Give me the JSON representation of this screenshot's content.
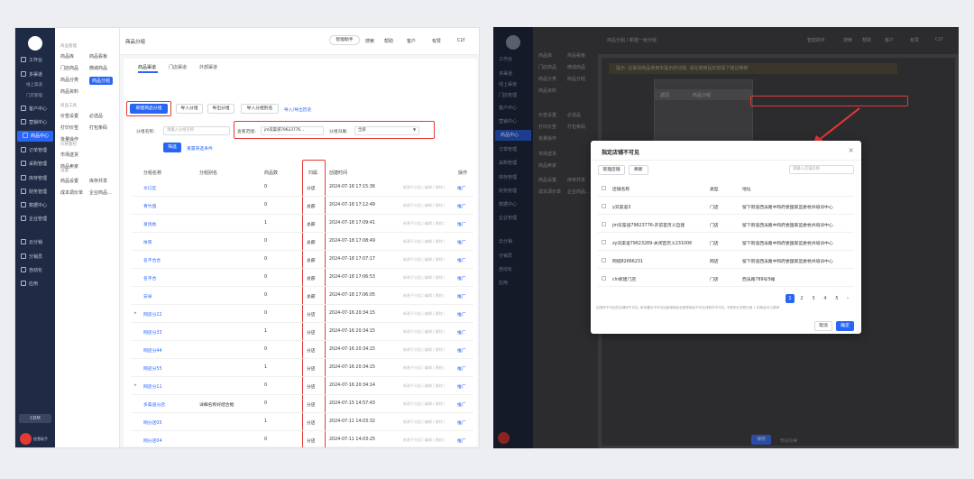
{
  "left": {
    "nav": {
      "items": [
        "工作台",
        "多渠道",
        "线上渠道",
        "门店管理",
        "客户中心",
        "营销中心",
        "商品中心",
        "订单管理",
        "采购管理",
        "库存管理",
        "财务管理",
        "数据中心",
        "企业管理",
        "云分销",
        "分销员",
        "自动化",
        "应用"
      ],
      "crm": "CRM",
      "foot": "经营助手"
    },
    "submenu": {
      "h1": "商品管理",
      "c1": [
        "商品库",
        "门店商品",
        "商品分类",
        "商品资料"
      ],
      "c2": [
        "商品看板",
        "微城商品",
        "商品分组"
      ],
      "h2": "商品工具",
      "c3": [
        "价签设置",
        "打印价签",
        "批量操作"
      ],
      "c4": [
        "必选品",
        "打包条码"
      ],
      "h3": "价格管控",
      "c5": [
        "市场送货",
        "商品卖家"
      ],
      "h4": "设置",
      "c6": [
        "商品设置",
        "成本调价单"
      ],
      "c7": [
        "库存共享",
        "企业商品..."
      ]
    },
    "topbar": {
      "title": "商品分组",
      "assistant": "智能助手",
      "search": "搜索",
      "help": "帮助",
      "customer": "客户",
      "news": "有赞",
      "user": "CLY"
    },
    "tabs": [
      "商品渠道",
      "门店渠道",
      "外部渠道"
    ],
    "toolbar": {
      "new": "新建商品分组",
      "import": "导入分组",
      "export": "导出分组",
      "import_alias": "导入分组别名",
      "history": "导入/导出历史"
    },
    "filters": {
      "name_label": "分组名称:",
      "name_ph": "请输入分组名称",
      "scope_label": "查看范围:",
      "scope_val": "jm双渠道79623776...",
      "belong_label": "分组归属:",
      "belong_val": "全部",
      "filter_btn": "筛选",
      "reset": "重置筛选条件"
    },
    "table": {
      "headers": [
        "分组名称",
        "分组别名",
        "商品数",
        "归属",
        "创建时间",
        "操作"
      ],
      "rows": [
        {
          "name": "文口区",
          "alias": "",
          "count": "0",
          "belong": "分店",
          "time": "2024-07-18 17:15:36"
        },
        {
          "name": "青竹亩",
          "alias": "",
          "count": "0",
          "belong": "总部",
          "time": "2024-07-18 17:12:49"
        },
        {
          "name": "发烧他",
          "alias": "",
          "count": "1",
          "belong": "总部",
          "time": "2024-07-18 17:09:41"
        },
        {
          "name": "体育",
          "alias": "",
          "count": "0",
          "belong": "总部",
          "time": "2024-07-18 17:08:49"
        },
        {
          "name": "名不合合",
          "alias": "",
          "count": "0",
          "belong": "总部",
          "time": "2024-07-18 17:07:17"
        },
        {
          "name": "名平合",
          "alias": "",
          "count": "0",
          "belong": "总部",
          "time": "2024-07-18 17:06:53"
        },
        {
          "name": "安卓",
          "alias": "",
          "count": "0",
          "belong": "总部",
          "time": "2024-07-18 17:06:05"
        },
        {
          "name": "网店分22",
          "alias": "",
          "count": "0",
          "belong": "分店",
          "time": "2024-07-16 20:34:15"
        },
        {
          "name": "网店分33",
          "alias": "",
          "count": "1",
          "belong": "分店",
          "time": "2024-07-16 20:34:15"
        },
        {
          "name": "网店分44",
          "alias": "",
          "count": "0",
          "belong": "分店",
          "time": "2024-07-16 20:34:15"
        },
        {
          "name": "网店分55",
          "alias": "",
          "count": "1",
          "belong": "分店",
          "time": "2024-07-16 20:34:15"
        },
        {
          "name": "网店分11",
          "alias": "",
          "count": "0",
          "belong": "分店",
          "time": "2024-07-16 20:34:14"
        },
        {
          "name": "多渠道分店",
          "alias": "详细名称好结合框",
          "count": "0",
          "belong": "分店",
          "time": "2024-07-15 14:57:43"
        },
        {
          "name": "网分店05",
          "alias": "",
          "count": "1",
          "belong": "分店",
          "time": "2024-07-11 14:03:32"
        },
        {
          "name": "网分店04",
          "alias": "",
          "count": "0",
          "belong": "分店",
          "time": "2024-07-11 14:03:25"
        },
        {
          "name": "网分店03",
          "alias": "",
          "count": "0",
          "belong": "分店",
          "time": "2024-07-11 14:03:04"
        }
      ],
      "op_gray": "新建子分组 | 编辑 | 删除 |",
      "op_blue": "推广"
    }
  },
  "right": {
    "breadcrumb": "商品分组 / 新建一级分组",
    "warn": "提示: 在渠道商品使用本提示的功能, 请在使用后的前提下建议推荐",
    "phone": {
      "back": "返回",
      "title": "商品分组"
    },
    "modal": {
      "title": "指定店铺不可见",
      "manage": "管理店铺",
      "refresh": "刷新",
      "search_ph": "请输入店铺名称",
      "headers": [
        "店铺名称",
        "类型",
        "地址"
      ],
      "rows": [
        {
          "name": "y双渠道3",
          "type": "门店",
          "addr": "留下街道西溪路中和府委国家监委杭州培训中心"
        },
        {
          "name": "jm双渠道79623776-开前首页义自建",
          "type": "门店",
          "addr": "留下街道西溪路中和府委国家监委杭州培训中心"
        },
        {
          "name": "zy双渠道79623289-关闭首页义231006",
          "type": "门店",
          "addr": "留下街道西溪路中和府委国家监委杭州培训中心"
        },
        {
          "name": "网城82666231",
          "type": "网店",
          "addr": "留下街道西溪路中和府委国家监委杭州培训中心"
        },
        {
          "name": "cln新建门店",
          "type": "门店",
          "addr": "西溪路789号5幢"
        }
      ],
      "pages": [
        "1",
        "2",
        "3",
        "4",
        "5"
      ],
      "note": "如选择不可见的店铺则不可见, 新设置为不可见后新增商品及推荐商品不可见或新时不可见, 不影响已关联分组 1 的商品可以推荐",
      "cancel": "取消",
      "ok": "确定"
    },
    "bottom": {
      "save": "保存",
      "preview": "预览效果"
    }
  },
  "colors": {
    "primary": "#2a66f5",
    "highlight": "#e53935",
    "nav": "#1f2a44"
  }
}
